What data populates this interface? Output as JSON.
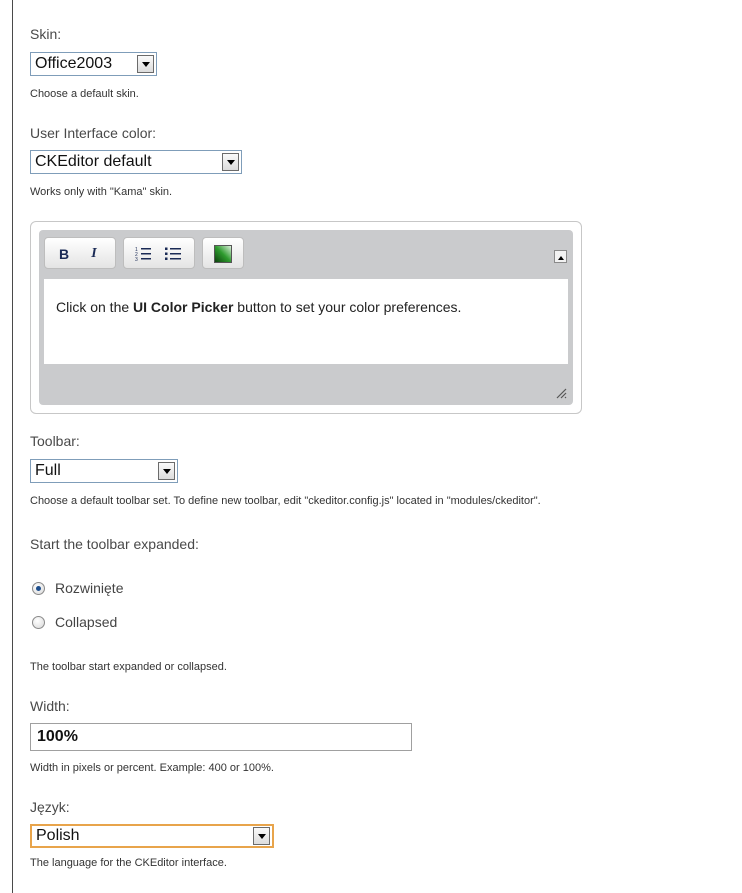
{
  "skin": {
    "label": "Skin:",
    "selected": "Office2003",
    "description": "Choose a default skin."
  },
  "ui_color": {
    "label": "User Interface color:",
    "selected": "CKEditor default",
    "description": "Works only with \"Kama\" skin."
  },
  "editor": {
    "toolbar": {
      "bold_label": "B",
      "italic_label": "I"
    },
    "text_before": "Click on the ",
    "text_bold": "UI Color Picker",
    "text_after": " button to set your color preferences."
  },
  "toolbar_setting": {
    "label": "Toolbar:",
    "selected": "Full",
    "description": "Choose a default toolbar set. To define new toolbar, edit \"ckeditor.config.js\" located in \"modules/ckeditor\"."
  },
  "toolbar_start": {
    "label": "Start the toolbar expanded:",
    "options": [
      {
        "label": "Rozwinięte",
        "checked": true
      },
      {
        "label": "Collapsed",
        "checked": false
      }
    ],
    "description": "The toolbar start expanded or collapsed."
  },
  "width": {
    "label": "Width:",
    "value": "100%",
    "description": "Width in pixels or percent. Example: 400 or 100%."
  },
  "language": {
    "label": "Język:",
    "selected": "Polish",
    "description": "The language for the CKEditor interface."
  }
}
